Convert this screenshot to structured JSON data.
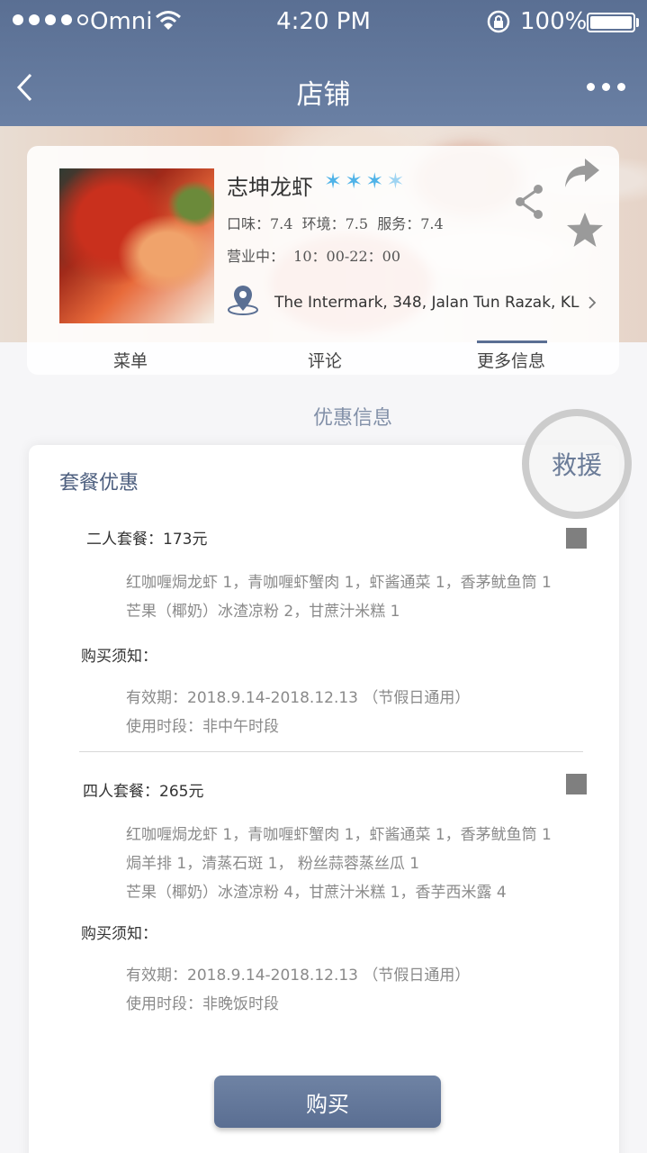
{
  "status_bar": {
    "carrier": "Omni",
    "time": "4:20 PM",
    "battery_pct": "100%"
  },
  "nav": {
    "title": "店铺"
  },
  "shop": {
    "name": "志坤龙虾",
    "star_rating": 3.5,
    "ratings": "口味：7.4  环境：7.5  服务：7.4",
    "hours": "营业中：  10：00-22：00",
    "address": "The Intermark, 348, Jalan Tun Razak, KL"
  },
  "tabs": [
    {
      "label": "菜单",
      "active": false
    },
    {
      "label": "评论",
      "active": false
    },
    {
      "label": "更多信息",
      "active": true
    }
  ],
  "section_title": "优惠信息",
  "deals": {
    "heading": "套餐优惠",
    "packages": [
      {
        "title": "二人套餐：173元",
        "items": [
          "红咖喱焗龙虾 1，青咖喱虾蟹肉 1，虾酱通菜 1，香茅鱿鱼筒 1",
          "芒果（椰奶）冰渣凉粉 2，甘蔗汁米糕 1"
        ],
        "notice_label": "购买须知：",
        "notice": [
          "有效期：2018.9.14-2018.12.13 （节假日通用）",
          "使用时段：非中午时段"
        ]
      },
      {
        "title": "四人套餐：265元",
        "items": [
          "红咖喱焗龙虾 1，青咖喱虾蟹肉 1，虾酱通菜 1，香茅鱿鱼筒 1",
          "焗羊排 1，清蒸石斑 1， 粉丝蒜蓉蒸丝瓜 1",
          "芒果（椰奶）冰渣凉粉 4，甘蔗汁米糕 1，香芋西米露 4"
        ],
        "notice_label": "购买须知：",
        "notice": [
          "有效期：2018.9.14-2018.12.13 （节假日通用）",
          "使用时段：非晚饭时段"
        ]
      }
    ]
  },
  "rescue_label": "救援",
  "buy_label": "购买",
  "colors": {
    "nav_bar": "#5a6f93",
    "star": "#4fb3e8",
    "accent_text": "#4c5e7e"
  }
}
